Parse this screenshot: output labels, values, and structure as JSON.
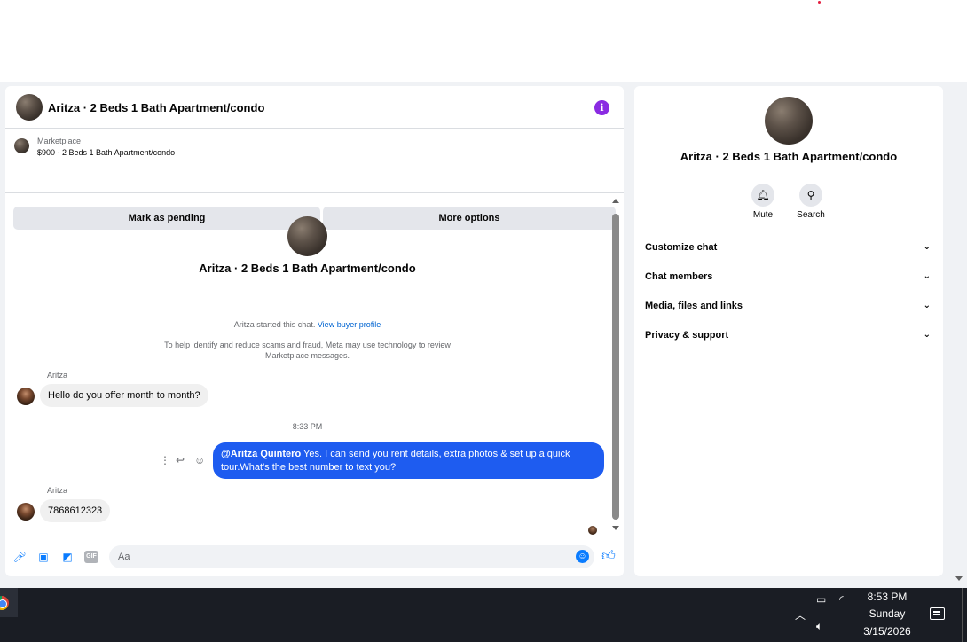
{
  "chat": {
    "title": "Aritza · 2 Beds 1 Bath Apartment/condo",
    "marketplace_label": "Marketplace",
    "listing": "$900 - 2 Beds 1 Bath Apartment/condo",
    "mark_pending_label": "Mark as pending",
    "more_options_label": "More options",
    "started_text": "Aritza started this chat.",
    "view_profile_link": "View buyer profile",
    "scam_note": "To help identify and reduce scams and fraud, Meta may use technology to review Marketplace messages.",
    "messages": [
      {
        "sender": "Aritza",
        "text": "Hello do you offer month to month?",
        "direction": "incoming"
      },
      {
        "time": "8:33 PM"
      },
      {
        "mention": "@Aritza Quintero",
        "text": " Yes.  I can send you rent details, extra photos & set up a quick tour.What's the best number to text you?",
        "direction": "outgoing"
      },
      {
        "sender": "Aritza",
        "text": "7868612323",
        "direction": "incoming"
      }
    ],
    "composer_placeholder": "Aa",
    "gif_label": "GIF"
  },
  "info_panel": {
    "title": "Aritza · 2 Beds 1 Bath Apartment/condo",
    "actions": [
      {
        "label": "Mute",
        "icon": "bell-icon"
      },
      {
        "label": "Search",
        "icon": "search-icon"
      }
    ],
    "sections": [
      "Customize chat",
      "Chat members",
      "Media, files and links",
      "Privacy & support"
    ]
  },
  "taskbar": {
    "time": "8:53 PM",
    "day": "Sunday",
    "date": "3/15/2026"
  },
  "colors": {
    "accent": "#0a7cff",
    "outgoing_bubble": "#1e5cf0",
    "info_icon": "#8a2be2"
  }
}
